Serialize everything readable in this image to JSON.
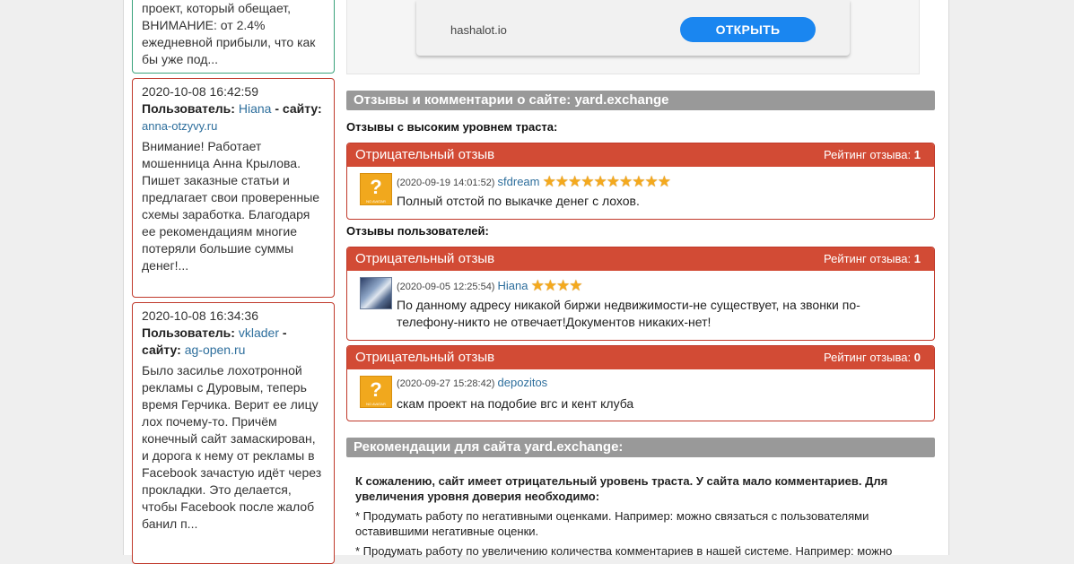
{
  "sidebar": {
    "card0": {
      "text": "проект, который обещает, ВНИМАНИЕ: от 2.4% ежедневной прибыли, что как бы уже под..."
    },
    "card1": {
      "date": "2020-10-08 16:42:59",
      "user_label": "Пользователь:",
      "user": "Hiana",
      "site_label": "- сайту:",
      "site": "anna-otzyvy.ru",
      "text": "Внимание! Работает мошенница Анна Крылова. Пишет заказные статьи и предлагает свои проверенные схемы заработка. Благодаря ее рекомендациям многие потеряли большие суммы денег!..."
    },
    "card2": {
      "date": "2020-10-08 16:34:36",
      "user_label": "Пользователь:",
      "user": "vklader",
      "site_label": "- сайту:",
      "site": "ag-open.ru",
      "text": "Было засилье лохотронной рекламы с Дуровым, теперь время Герчика. Верит ее лицу лох почему-то. Причём конечный сайт замаскирован, и дорога к нему от рекламы в Facebook зачастую идёт через прокладки. Это делается, чтобы Facebook после жалоб банил п..."
    }
  },
  "ad": {
    "domain": "hashalot.io",
    "button": "ОТКРЫТЬ"
  },
  "reviews_section": {
    "title": "Отзывы и комментарии о сайте: yard.exchange",
    "high_trust_label": "Отзывы с высоким уровнем траста:",
    "users_label": "Отзывы пользователей:",
    "rating_label": "Рейтинг отзыва:",
    "items": [
      {
        "type": "Отрицательный отзыв",
        "rating": "1",
        "date": "(2020-09-19 14:01:52)",
        "user": "sfdream",
        "stars": "★★★★★★★★★★",
        "star_count": 10,
        "avatar": "?",
        "text": "Полный отстой по выкачке денег с лохов."
      },
      {
        "type": "Отрицательный отзыв",
        "rating": "1",
        "date": "(2020-09-05 12:25:54)",
        "user": "Hiana",
        "stars": "★★★★",
        "star_count": 4,
        "avatar": "",
        "text": "По данному адресу никакой биржи недвижимости-не существует, на звонки по-телефону-никто не отвечает!Документов никаких-нет!"
      },
      {
        "type": "Отрицательный отзыв",
        "rating": "0",
        "date": "(2020-09-27 15:28:42)",
        "user": "depozitos",
        "stars": "",
        "star_count": 0,
        "avatar": "?",
        "text": "скам проект на подобие вгс и кент клуба"
      }
    ]
  },
  "recommendations": {
    "title": "Рекомендации для сайта yard.exchange:",
    "intro": "К сожалению, сайт имеет отрицательный уровень траста. У сайта мало комментариев. Для увеличения уровня доверия необходимо:",
    "item1": "* Продумать работу по негативными оценками. Например: можно связаться с пользователями оставившими негативные оценки.",
    "item2": "* Продумать работу по увеличению количества комментариев в нашей системе. Например: можно"
  },
  "colors": {
    "negative_header": "#d24b35",
    "negative_border": "#c0392b",
    "section_header": "#999999",
    "link": "#2d6e9c",
    "ad_button": "#1a86f0"
  }
}
